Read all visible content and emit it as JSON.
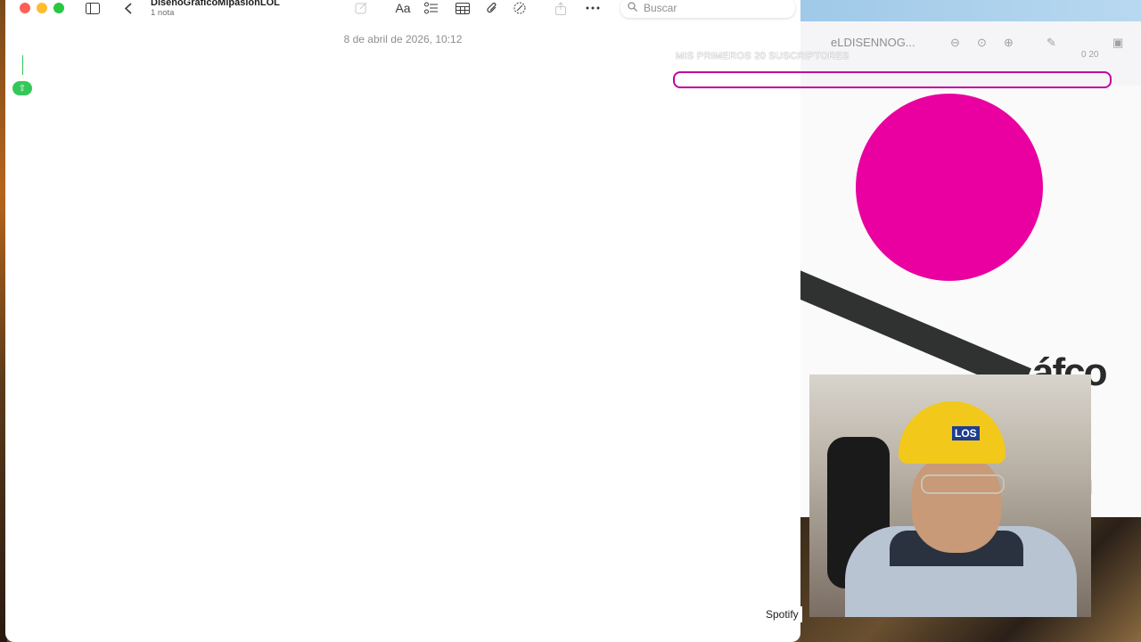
{
  "notes": {
    "folder_title": "DisenoGraficoMipasionLOL",
    "note_count": "1 nota",
    "date": "8 de abril de 2026, 10:12",
    "search_placeholder": "Buscar",
    "format_label": "Aa",
    "toolbar_icons": [
      "compose-icon",
      "format-icon",
      "checklist-icon",
      "table-icon",
      "attachment-icon",
      "collaborate-icon",
      "share-icon",
      "more-icon"
    ]
  },
  "design_app": {
    "doc_title": "eLDISENNOG...",
    "banner_text": "MIS PRIMEROS 20 SUSCRIPTORES",
    "counter": "0  20",
    "canvas_text_1": "áfco",
    "canvas_text_2": "n",
    "colors": {
      "circle": "#ea00a0",
      "bar": "#2f3230",
      "highlight": "#c000a0"
    }
  },
  "dock_tooltip": "Spotify"
}
